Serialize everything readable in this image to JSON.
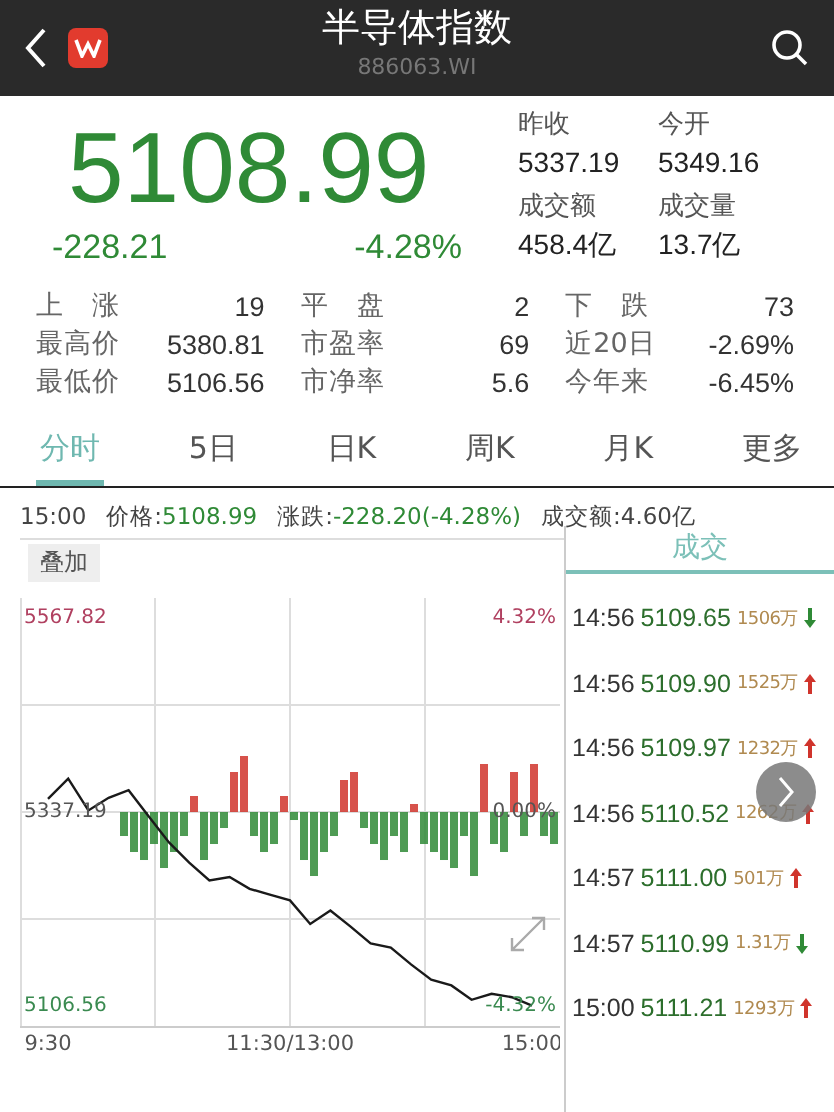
{
  "header": {
    "title": "半导体指数",
    "code": "886063.WI"
  },
  "quote": {
    "price": "5108.99",
    "change": "-228.21",
    "change_pct": "-4.28%",
    "falling": true
  },
  "summary": [
    {
      "label": "昨收",
      "value": "5337.19"
    },
    {
      "label": "今开",
      "value": "5349.16"
    },
    {
      "label": "成交额",
      "value": "458.4亿"
    },
    {
      "label": "成交量",
      "value": "13.7亿"
    }
  ],
  "stats": [
    {
      "label": "上　涨",
      "value": "19"
    },
    {
      "label": "平　盘",
      "value": "2"
    },
    {
      "label": "下　跌",
      "value": "73"
    },
    {
      "label": "最高价",
      "value": "5380.81"
    },
    {
      "label": "市盈率",
      "value": "69"
    },
    {
      "label": "近20日",
      "value": "-2.69%"
    },
    {
      "label": "最低价",
      "value": "5106.56"
    },
    {
      "label": "市净率",
      "value": "5.6"
    },
    {
      "label": "今年来",
      "value": "-6.45%"
    }
  ],
  "tabs": [
    {
      "label": "分时",
      "selected": true
    },
    {
      "label": "5日",
      "selected": false
    },
    {
      "label": "日K",
      "selected": false
    },
    {
      "label": "周K",
      "selected": false
    },
    {
      "label": "月K",
      "selected": false
    },
    {
      "label": "更多",
      "selected": false
    }
  ],
  "info_line": {
    "time": "15:00",
    "price_label": "价格:",
    "price": "5108.99",
    "change_label": "涨跌:",
    "change": "-228.20(-4.28%)",
    "amount": "成交额:4.60亿"
  },
  "chart": {
    "overlay_button": "叠加",
    "right_labels": [
      "4.32%",
      "0.00%",
      "-4.32%"
    ],
    "chart_data": {
      "type": "line",
      "categories": [
        "9:30",
        null,
        null,
        null,
        null,
        null,
        null,
        null,
        null,
        null,
        null,
        null,
        "11:30/13:00",
        null,
        null,
        null,
        null,
        null,
        null,
        null,
        null,
        null,
        null,
        null,
        "15:00"
      ],
      "series": [
        {
          "color": "#1a1a1a",
          "values": [
            5353,
            5377,
            5339,
            5354,
            5363,
            5332,
            5301,
            5277,
            5256,
            5260,
            5246,
            5239,
            5232,
            5204,
            5220,
            5201,
            5181,
            5176,
            5156,
            5138,
            5131,
            5114,
            5121,
            5117,
            5107
          ]
        }
      ],
      "ylim": [
        5082.8,
        5591.6
      ],
      "yticks": [
        5567.82,
        5337.19,
        5106.56
      ]
    }
  },
  "trades": {
    "title": "成交",
    "rows": [
      {
        "time": "14:56",
        "price": "5109.65",
        "volume": "1506万",
        "rising": false
      },
      {
        "time": "14:56",
        "price": "5109.90",
        "volume": "1525万",
        "rising": true
      },
      {
        "time": "14:56",
        "price": "5109.97",
        "volume": "1232万",
        "rising": true
      },
      {
        "time": "14:56",
        "price": "5110.52",
        "volume": "1262万",
        "rising": true
      },
      {
        "time": "14:57",
        "price": "5111.00",
        "volume": "501万",
        "rising": true
      },
      {
        "time": "14:57",
        "price": "5110.99",
        "volume": "1.31万",
        "rising": false
      },
      {
        "time": "15:00",
        "price": "5111.21",
        "volume": "1293万",
        "rising": true
      }
    ]
  }
}
